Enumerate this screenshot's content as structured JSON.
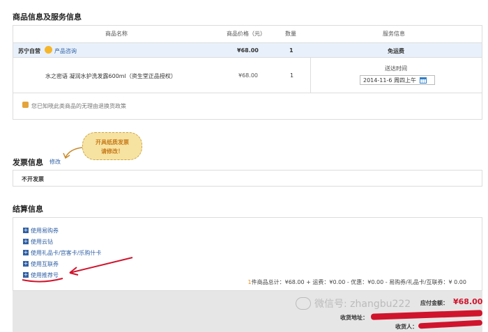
{
  "product_section": {
    "title": "商品信息及服务信息",
    "headers": {
      "name": "商品名称",
      "price": "商品价格（元）",
      "qty": "数量",
      "service": "服务信息"
    },
    "seller": {
      "name": "苏宁自营",
      "consult": "产品咨询",
      "price": "¥68.00",
      "qty": "1",
      "service": "免运费"
    },
    "item": {
      "name": "水之密语 凝润水护洗发露600ml（资生堂正品授权）",
      "price": "¥68.00",
      "qty": "1"
    },
    "delivery": {
      "label": "送达时间",
      "date": "2014-11-6 周四上午"
    },
    "notice": "您已知晓此类商品的无理由退换货政策"
  },
  "invoice_section": {
    "title": "发票信息",
    "edit": "修改",
    "sticker": {
      "line1": "开具纸质发票",
      "line2": "请修改！"
    },
    "value": "不开发票"
  },
  "settlement_section": {
    "title": "结算信息",
    "options": [
      "使用易购券",
      "使用云钻",
      "使用礼品卡/宫客卡/乐购什卡",
      "使用互联券",
      "使用推荐号"
    ],
    "summary": {
      "count": "1",
      "text": "件商品总计：¥68.00 + 运费：¥0.00 - 优惠：¥0.00 - 易购券/礼品卡/互联券：¥ 0.00"
    },
    "payable_label": "应付金额：",
    "payable_value": "¥68.00",
    "address_label": "收货地址：",
    "receiver_label": "收货人："
  },
  "watermark": {
    "text": "微信号: zhangbu222"
  },
  "colors": {
    "accent_red": "#d0142c",
    "link_blue": "#2f5fa3",
    "sticker_yellow": "#f7e3a1"
  }
}
